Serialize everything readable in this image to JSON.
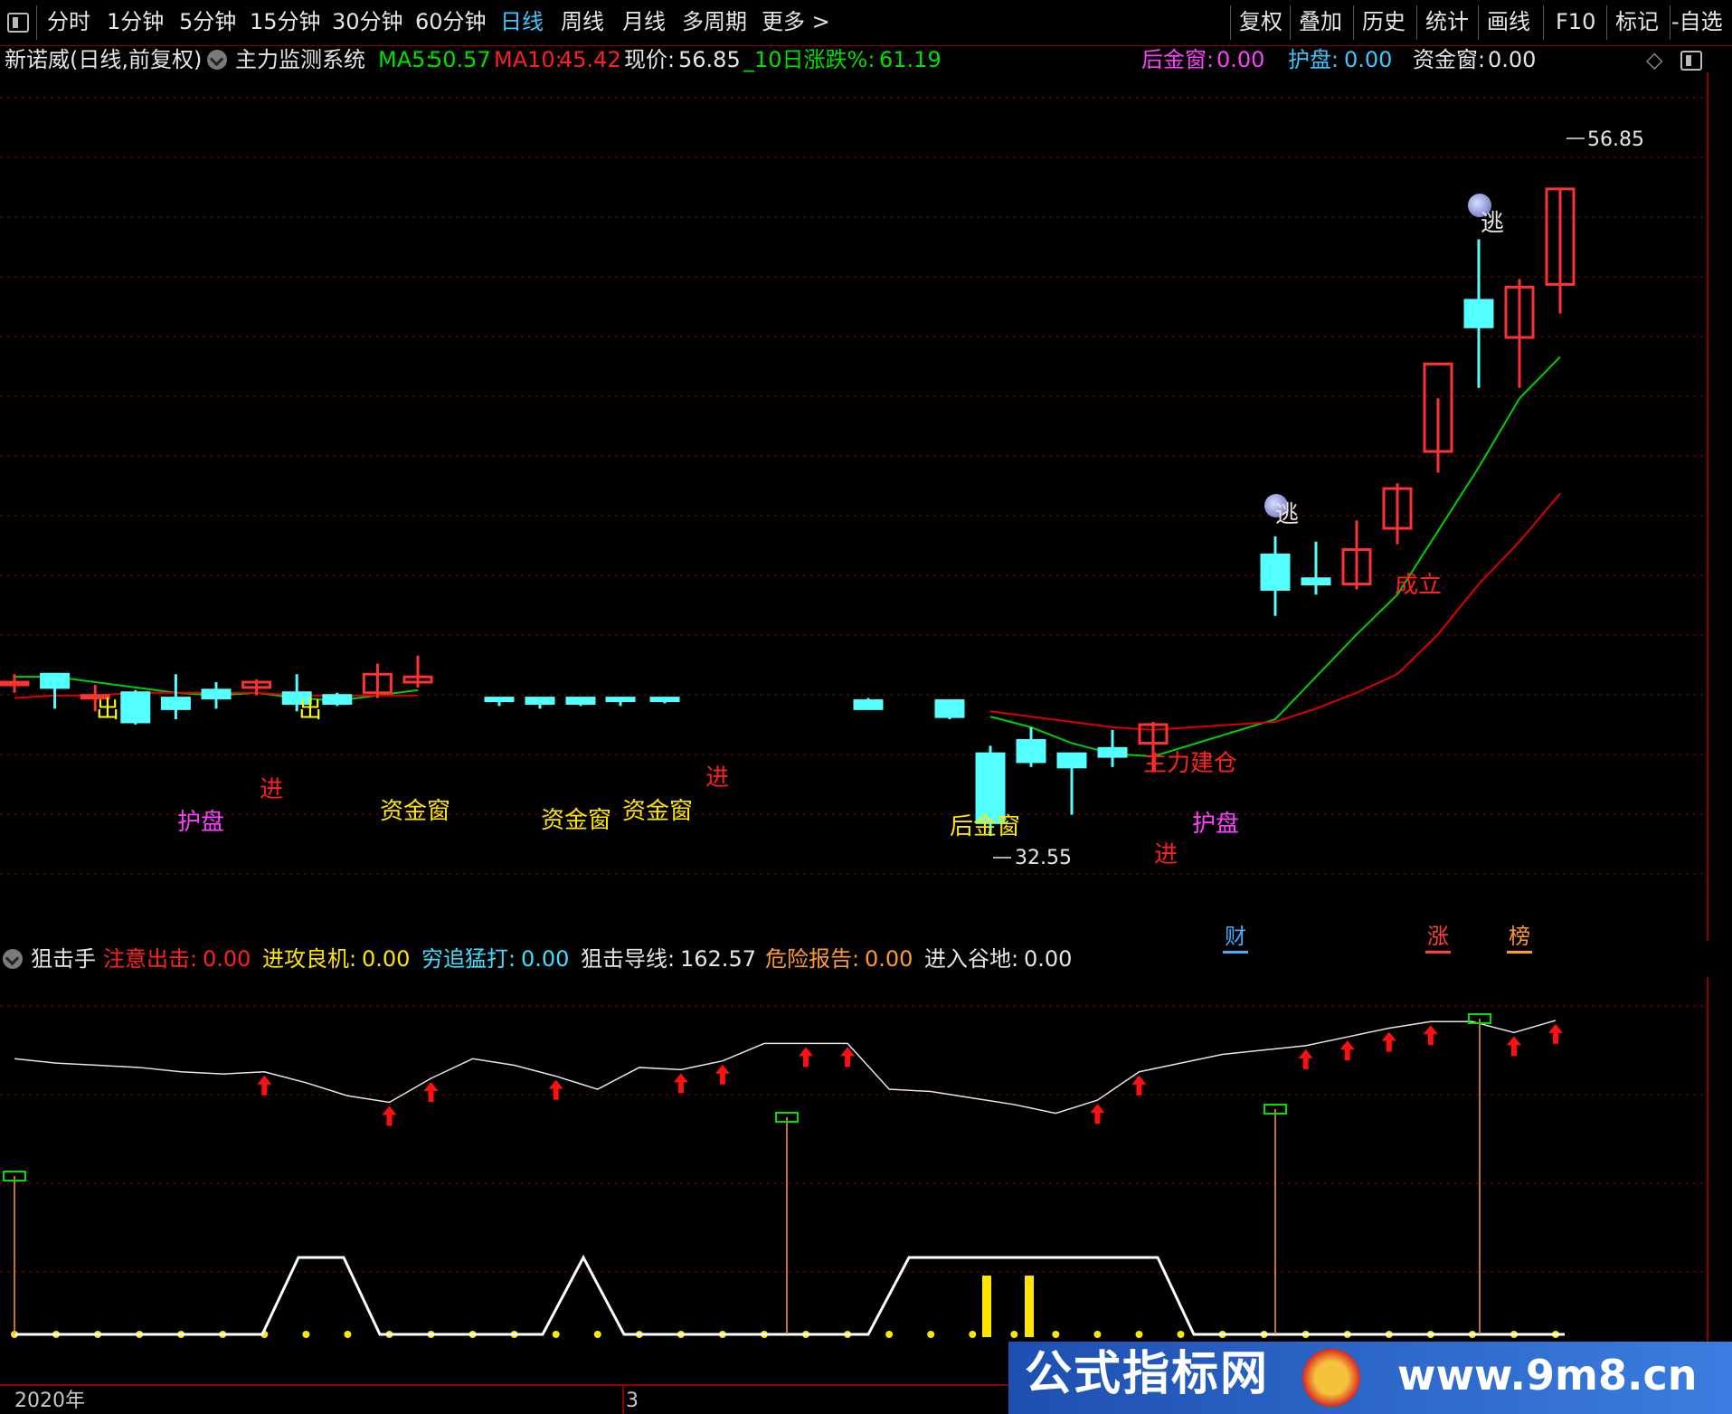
{
  "toolbar": {
    "left_items": [
      "分时",
      "1分钟",
      "5分钟",
      "15分钟",
      "30分钟",
      "60分钟",
      "日线",
      "周线",
      "月线",
      "多周期",
      "更多 >"
    ],
    "active_item": "日线",
    "right_items": [
      "复权",
      "叠加",
      "历史",
      "统计",
      "画线",
      "F10",
      "标记",
      "-自选"
    ]
  },
  "main_header": {
    "stock": "新诺威(日线,前复权)",
    "system": "主力监测系统",
    "ma5_label": "MA5:",
    "ma5_value": "50.57",
    "ma10_label": "MA10:",
    "ma10_value": "45.42",
    "price_label": "现价:",
    "price_value": "56.85",
    "chg_label": "_10日涨跌%:",
    "chg_value": "61.19",
    "hjc_label": "后金窗:",
    "hjc_value": "0.00",
    "hp_label": "护盘:",
    "hp_value": "0.00",
    "zjc_label": "资金窗:",
    "zjc_value": "0.00"
  },
  "main_chart": {
    "high_label": "56.85",
    "low_label": "32.55",
    "signals": {
      "chu": "出",
      "jin": "进",
      "hupan": "护盘",
      "zijinchuang": "资金窗",
      "houjinchuang": "后金窗",
      "zhulijiancang": "主力建仓",
      "chengli": "成立",
      "tao": "逃"
    },
    "badges": [
      "财",
      "涨",
      "榜"
    ],
    "colors": {
      "up": "#ff3232",
      "down": "#54ffff",
      "ma5": "#00d000",
      "ma10": "#dd0000",
      "grid": "#8a0000"
    }
  },
  "indicator_header": {
    "name": "狙击手",
    "f1_label": "注意出击:",
    "f1_value": "0.00",
    "f2_label": "进攻良机:",
    "f2_value": "0.00",
    "f3_label": "穷追猛打:",
    "f3_value": "0.00",
    "f4_label": "狙击导线:",
    "f4_value": "162.57",
    "f5_label": "危险报告:",
    "f5_value": "0.00",
    "f6_label": "进入谷地:",
    "f6_value": "0.00"
  },
  "time_axis": {
    "year_label": "2020年",
    "month_label": "3"
  },
  "watermark": {
    "text": "公式指标网",
    "url": "www.9m8.cn"
  },
  "chart_data": {
    "type": "candlestick",
    "price_range": [
      31,
      60
    ],
    "candles": [
      {
        "o": 38.3,
        "h": 38.6,
        "l": 37.9,
        "c": 38.3
      },
      {
        "o": 38.6,
        "h": 38.6,
        "l": 37.3,
        "c": 38.1
      },
      {
        "o": 37.8,
        "h": 38.2,
        "l": 37.2,
        "c": 37.8
      },
      {
        "o": 37.9,
        "h": 38.0,
        "l": 36.7,
        "c": 36.8
      },
      {
        "o": 37.7,
        "h": 38.6,
        "l": 36.9,
        "c": 37.3
      },
      {
        "o": 38.0,
        "h": 38.3,
        "l": 37.3,
        "c": 37.7
      },
      {
        "o": 38.1,
        "h": 38.4,
        "l": 37.8,
        "c": 38.3
      },
      {
        "o": 37.9,
        "h": 38.6,
        "l": 37.2,
        "c": 37.5
      },
      {
        "o": 37.8,
        "h": 37.9,
        "l": 37.4,
        "c": 37.5
      },
      {
        "o": 37.9,
        "h": 39.0,
        "l": 37.7,
        "c": 38.6
      },
      {
        "o": 38.3,
        "h": 39.3,
        "l": 38.1,
        "c": 38.5
      },
      {
        "o": 37.7,
        "h": 37.7,
        "l": 37.4,
        "c": 37.6
      },
      {
        "o": 37.7,
        "h": 37.7,
        "l": 37.3,
        "c": 37.5
      },
      {
        "o": 37.7,
        "h": 37.7,
        "l": 37.4,
        "c": 37.5
      },
      {
        "o": 37.7,
        "h": 37.7,
        "l": 37.4,
        "c": 37.6
      },
      {
        "o": 37.7,
        "h": 37.7,
        "l": 37.5,
        "c": 37.6
      },
      {
        "o": 37.6,
        "h": 37.7,
        "l": 37.3,
        "c": 37.3
      },
      {
        "o": 37.6,
        "h": 37.6,
        "l": 36.9,
        "c": 37.0
      },
      {
        "o": 35.6,
        "h": 35.9,
        "l": 32.5,
        "c": 33.0
      },
      {
        "o": 36.1,
        "h": 36.6,
        "l": 35.1,
        "c": 35.3
      },
      {
        "o": 35.6,
        "h": 35.6,
        "l": 33.3,
        "c": 35.1
      },
      {
        "o": 35.8,
        "h": 36.5,
        "l": 35.1,
        "c": 35.5
      },
      {
        "o": 36.0,
        "h": 36.8,
        "l": 34.9,
        "c": 36.7
      },
      {
        "o": 43.1,
        "h": 43.8,
        "l": 40.8,
        "c": 41.8
      },
      {
        "o": 42.2,
        "h": 43.6,
        "l": 41.6,
        "c": 42.0
      },
      {
        "o": 42.0,
        "h": 44.4,
        "l": 41.8,
        "c": 43.3
      },
      {
        "o": 44.1,
        "h": 45.8,
        "l": 43.5,
        "c": 45.6
      },
      {
        "o": 47.0,
        "h": 49.0,
        "l": 46.2,
        "c": 50.3
      },
      {
        "o": 52.7,
        "h": 55.0,
        "l": 49.4,
        "c": 51.7
      },
      {
        "o": 51.3,
        "h": 53.5,
        "l": 49.4,
        "c": 53.2
      },
      {
        "o": 53.3,
        "h": 56.9,
        "l": 52.2,
        "c": 56.9
      }
    ],
    "ma5": [
      38.5,
      38.5,
      38.3,
      38.1,
      37.9,
      37.8,
      37.9,
      37.7,
      37.6,
      37.8,
      38.0,
      null,
      null,
      null,
      null,
      null,
      null,
      null,
      37.0,
      36.6,
      36.0,
      35.6,
      35.5,
      36.9,
      38.5,
      40.1,
      41.6,
      44.0,
      46.4,
      49.0,
      50.57
    ],
    "ma10": [
      37.7,
      37.8,
      37.8,
      37.9,
      37.9,
      37.9,
      37.9,
      37.8,
      37.8,
      37.8,
      37.8,
      null,
      null,
      null,
      null,
      null,
      null,
      null,
      37.2,
      37.0,
      36.8,
      36.6,
      36.5,
      36.8,
      37.3,
      37.9,
      38.6,
      40.1,
      42.0,
      43.6,
      45.42
    ],
    "indicator": {
      "range": [
        0,
        170
      ],
      "guide_line": [
        145,
        143,
        142,
        141,
        139,
        138,
        139,
        134,
        128,
        125,
        136,
        145,
        142,
        137,
        131,
        141,
        140,
        144,
        152,
        152,
        152,
        131,
        130,
        127,
        124,
        120,
        126,
        139,
        143,
        147,
        149,
        151,
        155,
        159,
        162,
        162,
        157,
        162.57
      ]
    }
  }
}
